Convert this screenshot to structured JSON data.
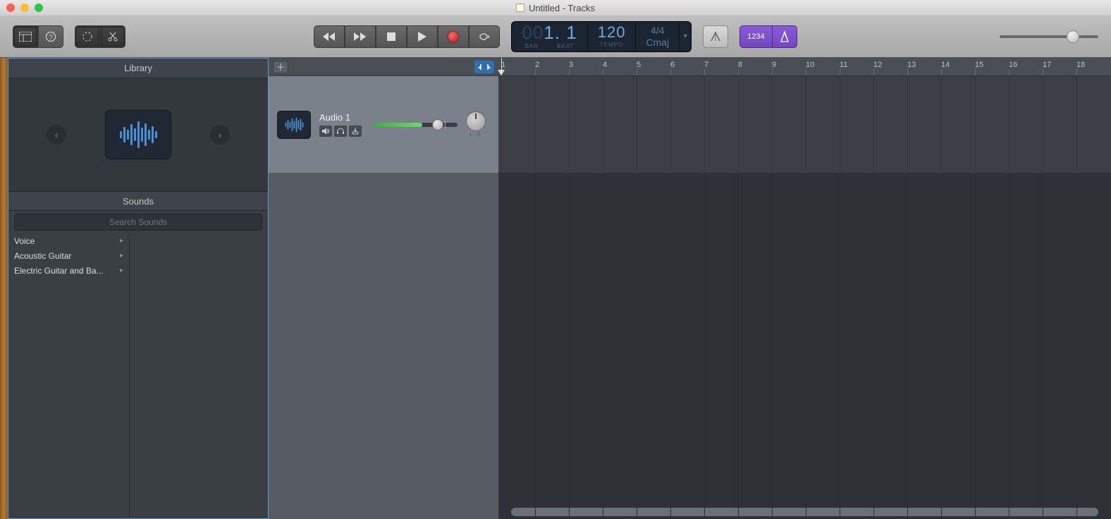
{
  "window": {
    "title": "Untitled - Tracks"
  },
  "lcd": {
    "bar_prefix": "00",
    "bar": "1. 1",
    "bar_label": "BAR",
    "beat_label": "BEAT",
    "tempo": "120",
    "tempo_label": "TEMPO",
    "time_sig": "4/4",
    "key": "Cmaj"
  },
  "display_mode": "1234",
  "library": {
    "title": "Library",
    "sounds_title": "Sounds",
    "search_placeholder": "Search Sounds",
    "categories": [
      {
        "label": "Voice"
      },
      {
        "label": "Acoustic Guitar"
      },
      {
        "label": "Electric Guitar and Ba..."
      }
    ]
  },
  "track": {
    "name": "Audio 1",
    "pan_label": "L   R"
  },
  "ruler": {
    "start": 1,
    "end": 18
  }
}
